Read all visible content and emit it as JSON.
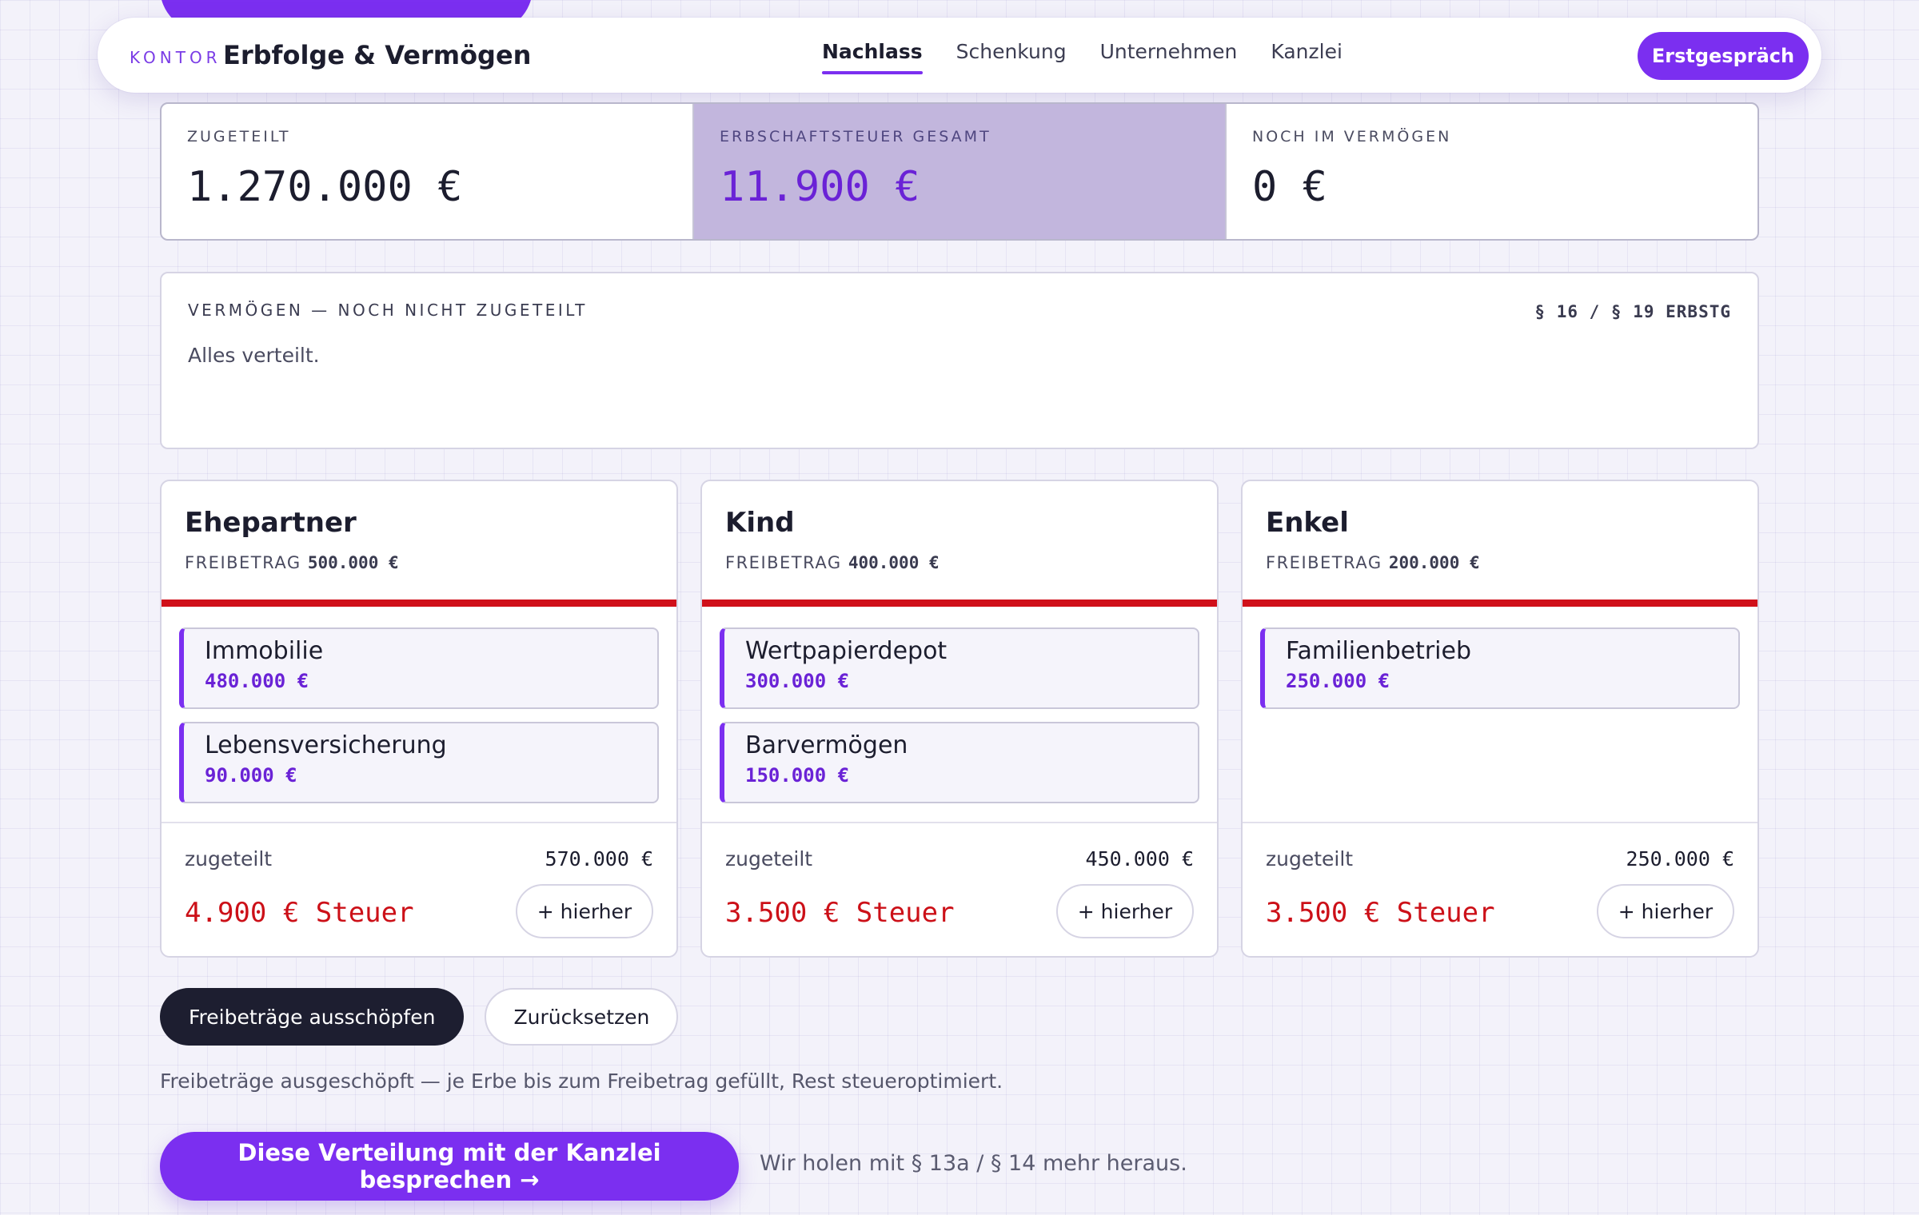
{
  "header": {
    "kicker": "KONTOR",
    "title": "Erbfolge & Vermögen",
    "nav": [
      {
        "label": "Nachlass",
        "active": true
      },
      {
        "label": "Schenkung",
        "active": false
      },
      {
        "label": "Unternehmen",
        "active": false
      },
      {
        "label": "Kanzlei",
        "active": false
      }
    ],
    "cta": "Erstgespräch"
  },
  "stats": [
    {
      "label": "ZUGETEILT",
      "value": "1.270.000 €"
    },
    {
      "label": "ERBSCHAFTSTEUER GESAMT",
      "value": "11.900 €"
    },
    {
      "label": "NOCH IM VERMÖGEN",
      "value": "0 €"
    }
  ],
  "pool": {
    "label": "VERMÖGEN — NOCH NICHT ZUGETEILT",
    "reference": "§ 16 / § 19 ERBSTG",
    "empty_text": "Alles verteilt."
  },
  "heirs": [
    {
      "name": "Ehepartner",
      "allowance_label": "FREIBETRAG",
      "allowance": "500.000 €",
      "items": [
        {
          "name": "Immobilie",
          "value": "480.000 €"
        },
        {
          "name": "Lebensversicherung",
          "value": "90.000 €"
        }
      ],
      "assigned_label": "zugeteilt",
      "assigned": "570.000 €",
      "tax": "4.900 € Steuer",
      "button": "+ hierher"
    },
    {
      "name": "Kind",
      "allowance_label": "FREIBETRAG",
      "allowance": "400.000 €",
      "items": [
        {
          "name": "Wertpapierdepot",
          "value": "300.000 €"
        },
        {
          "name": "Barvermögen",
          "value": "150.000 €"
        }
      ],
      "assigned_label": "zugeteilt",
      "assigned": "450.000 €",
      "tax": "3.500 € Steuer",
      "button": "+ hierher"
    },
    {
      "name": "Enkel",
      "allowance_label": "FREIBETRAG",
      "allowance": "200.000 €",
      "items": [
        {
          "name": "Familienbetrieb",
          "value": "250.000 €"
        }
      ],
      "assigned_label": "zugeteilt",
      "assigned": "250.000 €",
      "tax": "3.500 € Steuer",
      "button": "+ hierher"
    }
  ],
  "actions": {
    "optimize": "Freibeträge ausschöpfen",
    "reset": "Zurücksetzen",
    "hint": "Freibeträge ausgeschöpft — je Erbe bis zum Freibetrag gefüllt, Rest steueroptimiert."
  },
  "footer": {
    "cta": "Diese Verteilung mit der Kanzlei besprechen →",
    "note": "Wir holen mit § 13a / § 14 mehr heraus."
  },
  "colors": {
    "accent": "#7b2ff0",
    "tax_red": "#cc1018",
    "dark": "#1d1e30"
  }
}
